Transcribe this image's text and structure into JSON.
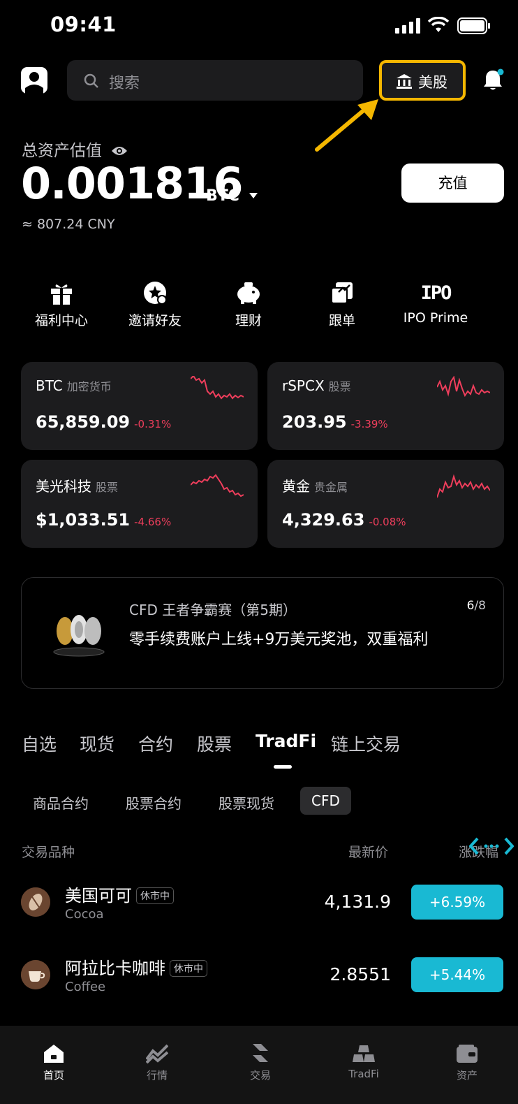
{
  "status_bar": {
    "time": "09:41"
  },
  "header": {
    "search_placeholder": "搜索",
    "market_button": "美股"
  },
  "assets": {
    "label": "总资产估值",
    "value": "0.001816",
    "unit": "BTC",
    "cny": "≈ 807.24 CNY",
    "deposit_button": "充值"
  },
  "quick_actions": [
    {
      "label": "福利中心",
      "icon": "gift-icon"
    },
    {
      "label": "邀请好友",
      "icon": "invite-icon"
    },
    {
      "label": "理财",
      "icon": "piggy-bank-icon"
    },
    {
      "label": "跟单",
      "icon": "copy-trade-icon"
    },
    {
      "label": "IPO Prime",
      "icon": "ipo-icon",
      "icon_text": "IPO"
    }
  ],
  "tickers": [
    {
      "name": "BTC",
      "tag": "加密货币",
      "price": "65,859.09",
      "change": "-0.31%"
    },
    {
      "name": "rSPCX",
      "tag": "股票",
      "price": "203.95",
      "change": "-3.39%"
    },
    {
      "name": "美光科技",
      "tag": "股票",
      "price": "$1,033.51",
      "change": "-4.66%"
    },
    {
      "name": "黄金",
      "tag": "贵金属",
      "price": "4,329.63",
      "change": "-0.08%"
    }
  ],
  "banner": {
    "title": "CFD 王者争霸赛（第5期）",
    "subtitle": "零手续费账户上线+9万美元奖池，双重福利",
    "page_current": "6",
    "page_total": "/8"
  },
  "tabs": [
    "自选",
    "现货",
    "合约",
    "股票",
    "TradFi",
    "链上交易"
  ],
  "active_tab": "TradFi",
  "subtabs": [
    "商品合约",
    "股票合约",
    "股票现货",
    "CFD"
  ],
  "active_subtab": "CFD",
  "table": {
    "headers": [
      "交易品种",
      "最新价",
      "涨跌幅"
    ],
    "rows": [
      {
        "name": "美国可可",
        "badge": "休市中",
        "sub": "Cocoa",
        "price": "4,131.9",
        "change": "+6.59%"
      },
      {
        "name": "阿拉比卡咖啡",
        "badge": "休市中",
        "sub": "Coffee",
        "price": "2.8551",
        "change": "+5.44%"
      }
    ]
  },
  "nav": [
    {
      "label": "首页",
      "icon": "home-icon"
    },
    {
      "label": "行情",
      "icon": "chart-icon"
    },
    {
      "label": "交易",
      "icon": "trade-icon"
    },
    {
      "label": "TradFi",
      "icon": "tradfi-icon"
    },
    {
      "label": "资产",
      "icon": "wallet-icon"
    }
  ],
  "colors": {
    "accent_highlight": "#f5b700",
    "negative": "#ef3e5c",
    "positive_badge": "#19b9d3"
  }
}
